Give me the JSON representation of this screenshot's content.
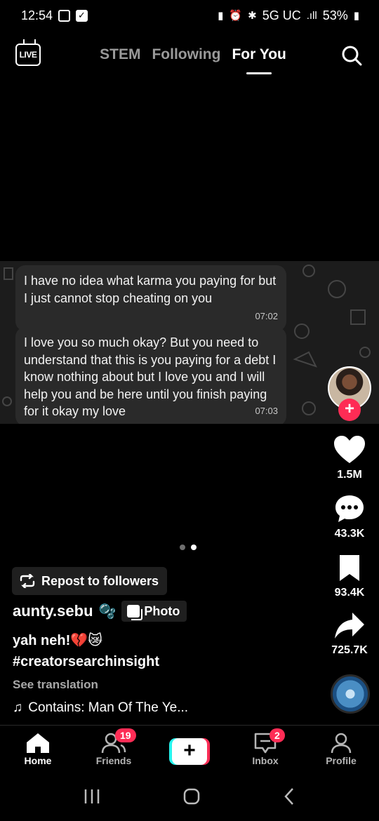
{
  "status_bar": {
    "time": "12:54",
    "network": "5G UC",
    "signal": ".ıll",
    "battery": "53%"
  },
  "top_nav": {
    "live_label": "LIVE",
    "tabs": [
      {
        "label": "STEM",
        "active": false
      },
      {
        "label": "Following",
        "active": false
      },
      {
        "label": "For You",
        "active": true
      }
    ]
  },
  "post_image": {
    "messages": [
      {
        "text": "I have no idea what karma you paying for but I just cannot stop cheating on you",
        "time": "07:02"
      },
      {
        "text": "I love you so much okay? But you need to understand that this is you paying for a debt I know nothing about but I love you and I will help you and be here until you finish paying for it okay my love",
        "time": "07:03"
      }
    ],
    "page_indicator": {
      "count": 2,
      "current": 2
    }
  },
  "rail": {
    "follow_icon": "+",
    "likes": "1.5M",
    "comments": "43.3K",
    "saves": "93.4K",
    "shares": "725.7K"
  },
  "post_info": {
    "repost_label": "Repost to followers",
    "username": "aunty.sebu",
    "username_emoji": "🫧",
    "photo_badge": "Photo",
    "caption": "yah neh!💔😿",
    "hashtag": "#creatorsearchinsight",
    "see_translation": "See translation",
    "music_note": "♫",
    "music": "Contains: Man Of The Ye..."
  },
  "bottom_nav": {
    "items": [
      {
        "label": "Home",
        "active": true
      },
      {
        "label": "Friends",
        "badge": "19"
      },
      {
        "label": "",
        "create": true
      },
      {
        "label": "Inbox",
        "badge": "2"
      },
      {
        "label": "Profile"
      }
    ],
    "create_symbol": "+"
  },
  "colors": {
    "accent": "#fe2c55",
    "cyan": "#25f4ee",
    "bg": "#000000"
  }
}
